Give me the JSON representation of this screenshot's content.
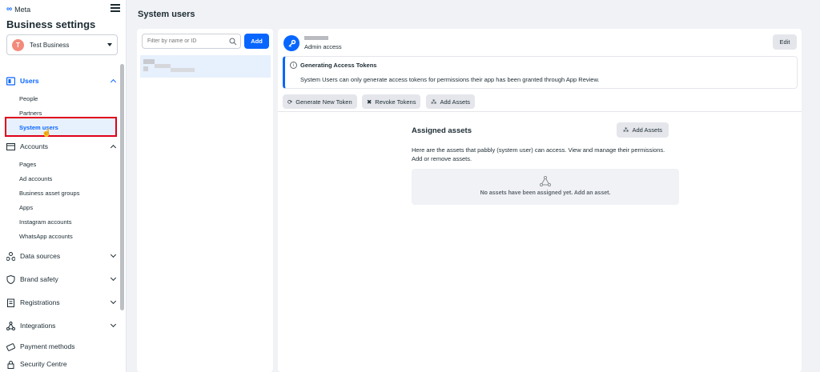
{
  "brand": "Meta",
  "sidebar": {
    "title": "Business settings",
    "business": {
      "initial": "T",
      "name": "Test Business"
    },
    "groups": [
      {
        "label": "Users",
        "icon": "users-icon",
        "expanded": true,
        "active": true
      },
      {
        "label": "Accounts",
        "icon": "accounts-icon",
        "expanded": true
      },
      {
        "label": "Data sources",
        "icon": "data-sources-icon",
        "expanded": false
      },
      {
        "label": "Brand safety",
        "icon": "shield-icon",
        "expanded": false
      },
      {
        "label": "Registrations",
        "icon": "registrations-icon",
        "expanded": false
      },
      {
        "label": "Integrations",
        "icon": "integrations-icon",
        "expanded": false
      },
      {
        "label": "Payment methods",
        "icon": "payment-icon"
      },
      {
        "label": "Security Centre",
        "icon": "lock-icon"
      }
    ],
    "users_items": [
      "People",
      "Partners",
      "System users"
    ],
    "accounts_items": [
      "Pages",
      "Ad accounts",
      "Business asset groups",
      "Apps",
      "Instagram accounts",
      "WhatsApp accounts"
    ]
  },
  "main": {
    "title": "System users",
    "search_placeholder": "Filter by name or ID",
    "add_label": "Add",
    "user": {
      "role": "Admin access",
      "edit_label": "Edit"
    },
    "info": {
      "title": "Generating Access Tokens",
      "text": "System Users can only generate access tokens for permissions their app has been granted through App Review."
    },
    "actions": [
      "Generate New Token",
      "Revoke Tokens",
      "Add Assets"
    ],
    "assigned": {
      "title": "Assigned assets",
      "add_label": "Add Assets",
      "desc": "Here are the assets that pabbly (system user) can access. View and manage their permissions. Add or remove assets.",
      "empty": "No assets have been assigned yet. Add an asset."
    }
  },
  "colors": {
    "accent": "#0866ff",
    "highlight": "#e0001b",
    "avatar": "#f28b7b"
  }
}
